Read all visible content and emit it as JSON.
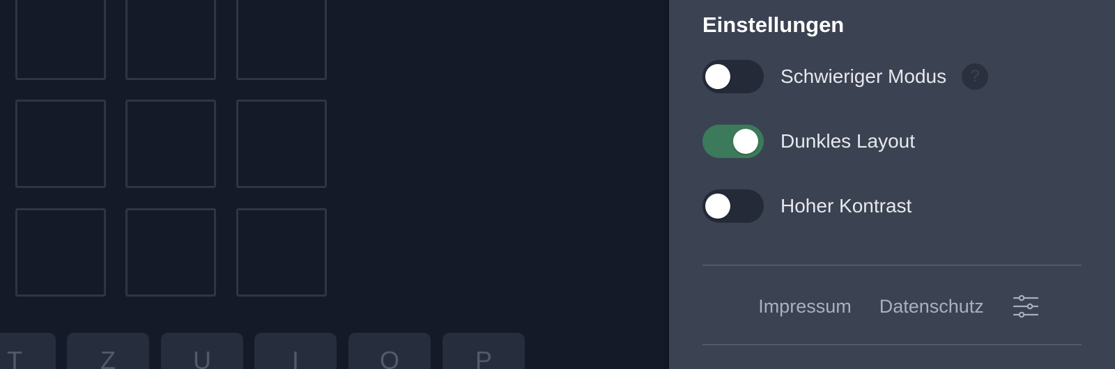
{
  "settings": {
    "title": "Einstellungen",
    "options": [
      {
        "label": "Schwieriger Modus",
        "enabled": false,
        "has_help": true,
        "help_icon": "question-icon",
        "help_glyph": "?"
      },
      {
        "label": "Dunkles Layout",
        "enabled": true
      },
      {
        "label": "Hoher Kontrast",
        "enabled": false
      }
    ],
    "footer": {
      "links": [
        "Impressum",
        "Datenschutz"
      ],
      "icon": "sliders-icon"
    }
  },
  "keyboard": {
    "visible_keys": [
      "T",
      "Z",
      "U",
      "I",
      "O",
      "P"
    ]
  },
  "colors": {
    "game_background": "#141a27",
    "panel_background": "#3b4252",
    "toggle_on": "#3b7a5a",
    "toggle_off": "#242a37",
    "tile_border": "#2e3544",
    "key_background": "#262d3d"
  }
}
